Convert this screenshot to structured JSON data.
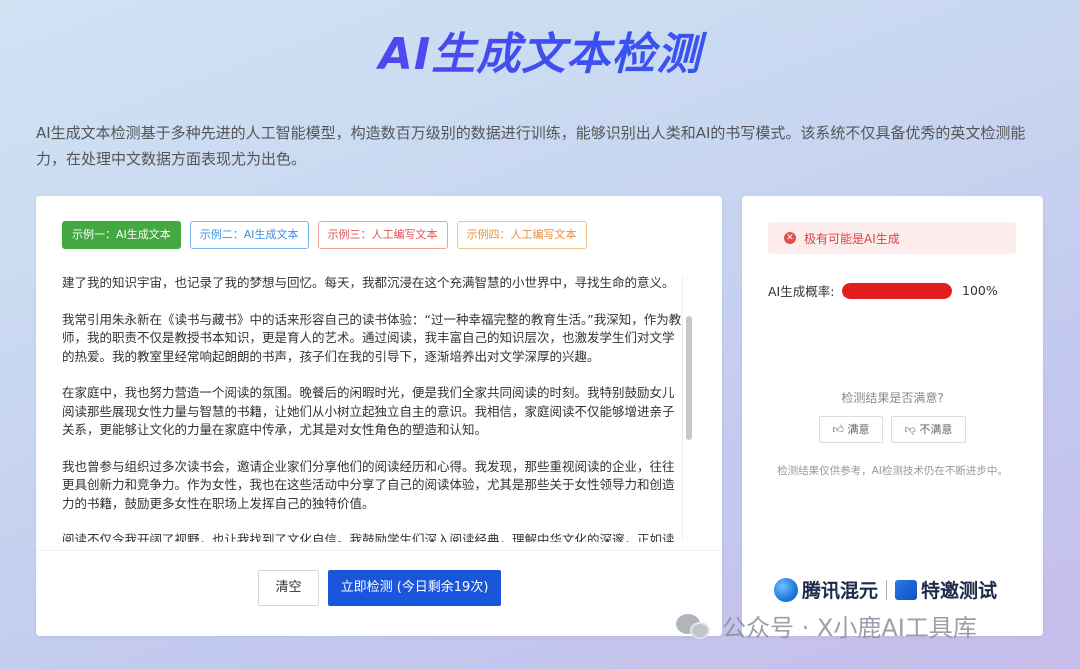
{
  "page": {
    "title": "AI生成文本检测",
    "intro": "AI生成文本检测基于多种先进的人工智能模型，构造数百万级别的数据进行训练，能够识别出人类和AI的书写模式。该系统不仅具备优秀的英文检测能力，在处理中文数据方面表现尤为出色。"
  },
  "examples": [
    {
      "label": "示例一：AI生成文本",
      "color": "#43a83f",
      "active": true
    },
    {
      "label": "示例二：AI生成文本",
      "color": "#3f8fe3",
      "active": false
    },
    {
      "label": "示例三：人工编写文本",
      "color": "#e05555",
      "active": false
    },
    {
      "label": "示例四：人工编写文本",
      "color": "#e8913a",
      "active": false
    }
  ],
  "editor": {
    "paragraphs": [
      "建了我的知识宇宙，也记录了我的梦想与回忆。每天，我都沉浸在这个充满智慧的小世界中，寻找生命的意义。",
      "我常引用朱永新在《读书与藏书》中的话来形容自己的读书体验：“过一种幸福完整的教育生活。”我深知，作为教师，我的职责不仅是教授书本知识，更是育人的艺术。通过阅读，我丰富自己的知识层次，也激发学生们对文学的热爱。我的教室里经常响起朗朗的书声，孩子们在我的引导下，逐渐培养出对文学深厚的兴趣。",
      "在家庭中，我也努力营造一个阅读的氛围。晚餐后的闲暇时光，便是我们全家共同阅读的时刻。我特别鼓励女儿阅读那些展现女性力量与智慧的书籍，让她们从小树立起独立自主的意识。我相信，家庭阅读不仅能够增进亲子关系，更能够让文化的力量在家庭中传承，尤其是对女性角色的塑造和认知。",
      "我也曾参与组织过多次读书会，邀请企业家们分享他们的阅读经历和心得。我发现，那些重视阅读的企业，往往更具创新力和竞争力。作为女性，我也在这些活动中分享了自己的阅读体验，尤其是那些关于女性领导力和创造力的书籍，鼓励更多女性在职场上发挥自己的独特价值。",
      "阅读不仅令我开阔了视野，也让我找到了文化自信。我鼓励学生们深入阅读经典，理解中华文化的深邃，正如读书"
    ],
    "clear_label": "清空",
    "detect_label": "立即检测 (今日剩余19次)",
    "scroll_position": 0.15
  },
  "result": {
    "alert_text": "极有可能是AI生成",
    "alert_icon": "close-circle-icon",
    "prob_label": "AI生成概率:",
    "prob_value": 100,
    "prob_text": "100%",
    "prob_color": "#e21e1e",
    "satisfy_question": "检测结果是否满意?",
    "good_label": "满意",
    "bad_label": "不满意",
    "note": "检测结果仅供参考，AI检测技术仍在不断进步中。",
    "logo_text": "腾讯混元",
    "logo_text2": "特邀测试"
  },
  "watermark": {
    "text": "公众号 · X小鹿AI工具库"
  }
}
